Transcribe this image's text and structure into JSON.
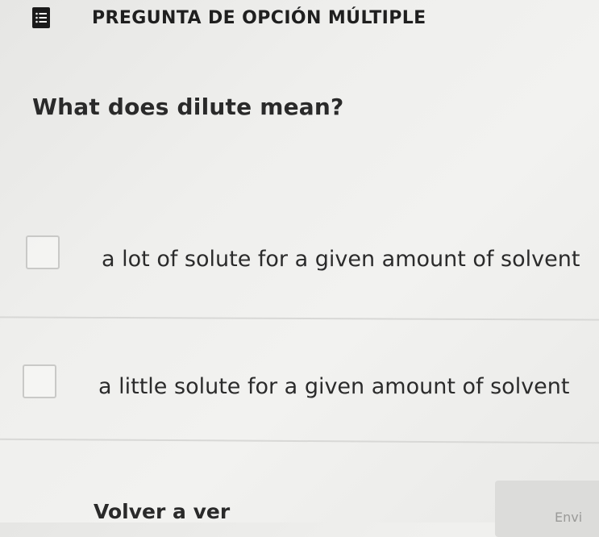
{
  "header": {
    "icon": "list-icon",
    "title": "PREGUNTA DE OPCIÓN MÚLTIPLE"
  },
  "question": {
    "text": "What does dilute mean?"
  },
  "options": [
    {
      "label": "a lot of solute for a given amount of solvent",
      "checked": false
    },
    {
      "label": "a little solute for a given amount of solvent",
      "checked": false
    }
  ],
  "footer": {
    "review_label": "Volver a ver",
    "submit_label": "Envi"
  },
  "colors": {
    "background": "#efefed",
    "text": "#1d1d1d",
    "icon_bg": "#1a1a1a",
    "checkbox_border": "#c9c9c7",
    "divider": "#d8d8d6",
    "button_bg": "#dcdcda"
  }
}
